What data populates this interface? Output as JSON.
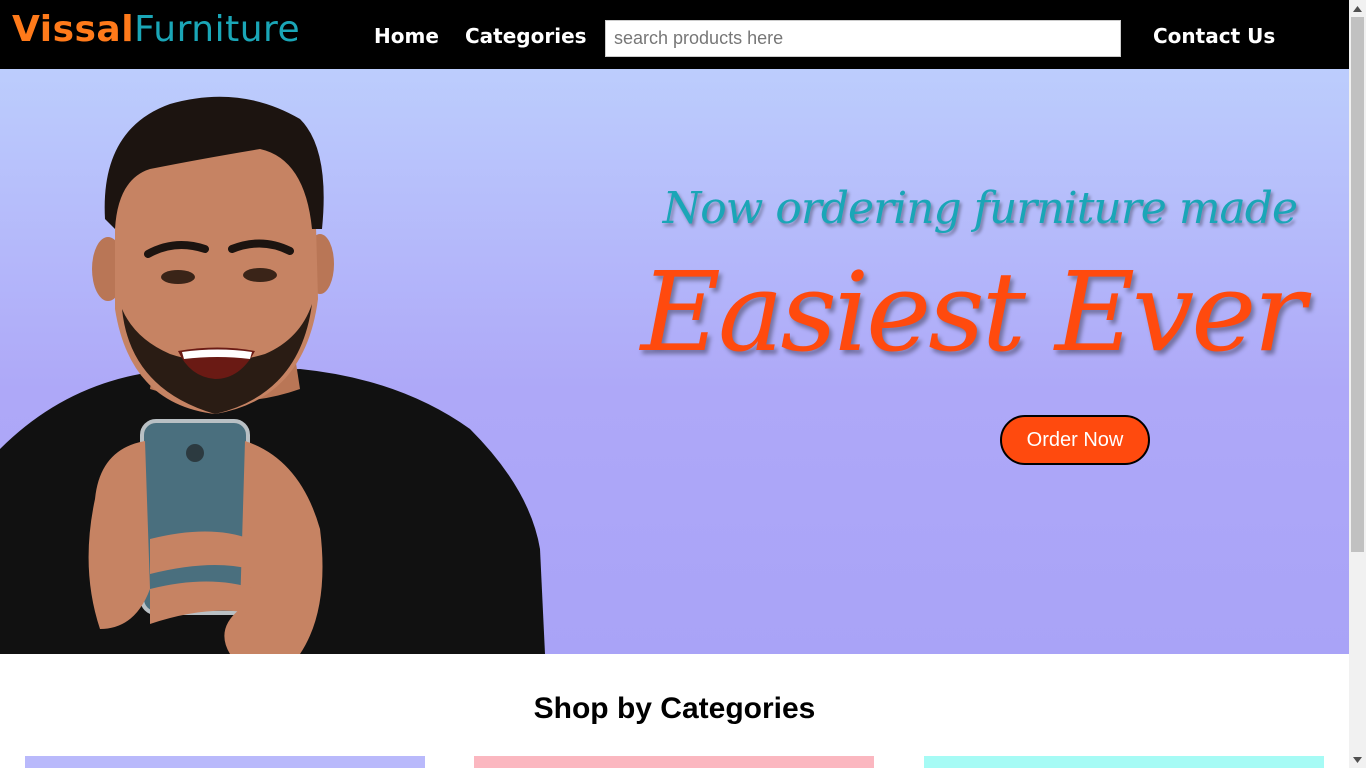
{
  "brand": {
    "part1": "Vissal",
    "part2": "Furniture",
    "color1": "#ff7a1a",
    "color2": "#1aa6b7"
  },
  "nav": {
    "home": "Home",
    "categories": "Categories",
    "contact": "Contact Us",
    "search": {
      "placeholder": "search products here",
      "value": ""
    }
  },
  "hero": {
    "tagline": "Now ordering furniture made",
    "headline": "Easiest Ever",
    "cta": "Order Now",
    "accent": "#ff4a0e",
    "image": "smiling man holding smartphone"
  },
  "categories": {
    "title": "Shop by Categories",
    "card_colors": [
      "#b9b9fb",
      "#fbb7c0",
      "#a6fbf5"
    ]
  },
  "icons": {
    "scroll_up": "chevron-up-icon",
    "scroll_down": "chevron-down-icon"
  }
}
